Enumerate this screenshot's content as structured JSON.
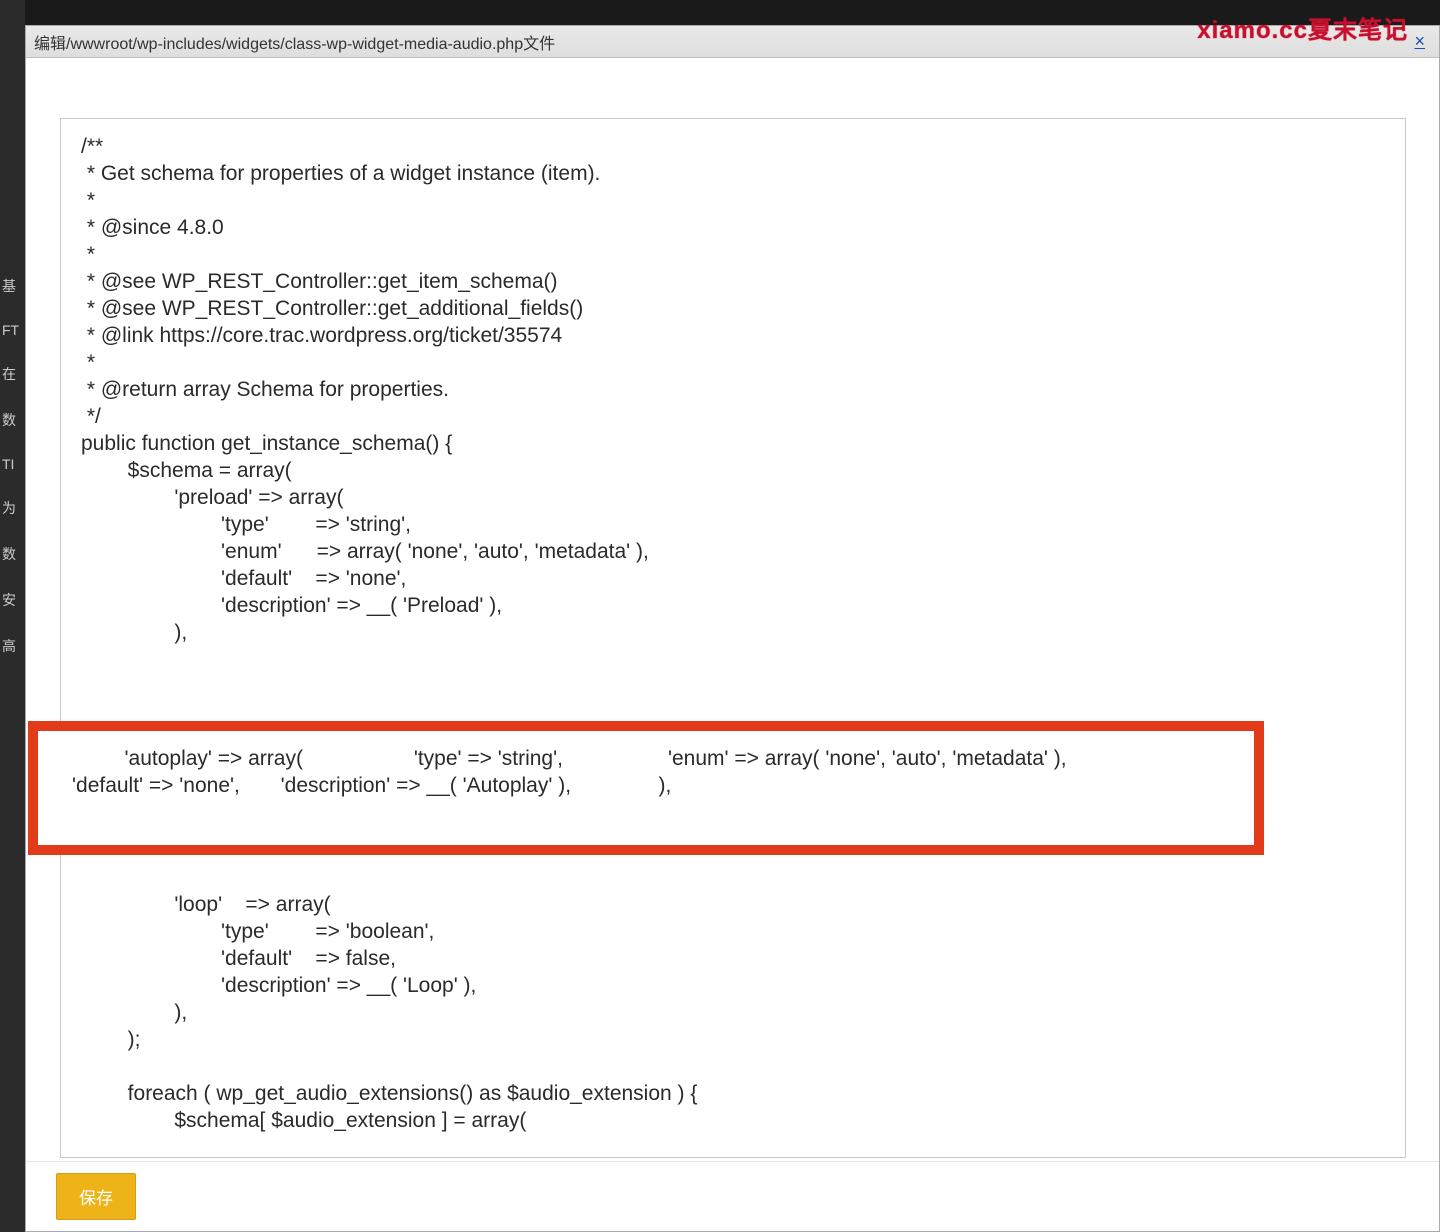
{
  "watermark": "xiamo.cc夏末笔记",
  "sidebar_items": [
    "基",
    "FT",
    "在",
    "数",
    "TI",
    "为",
    "数",
    "安",
    "高"
  ],
  "titlebar": {
    "title": "编辑/wwwroot/wp-includes/widgets/class-wp-widget-media-audio.php文件",
    "close_label": "×"
  },
  "code_before": "/**\n * Get schema for properties of a widget instance (item).\n *\n * @since 4.8.0\n *\n * @see WP_REST_Controller::get_item_schema()\n * @see WP_REST_Controller::get_additional_fields()\n * @link https://core.trac.wordpress.org/ticket/35574\n *\n * @return array Schema for properties.\n */\npublic function get_instance_schema() {\n        $schema = array(\n                'preload' => array(\n                        'type'        => 'string',\n                        'enum'      => array( 'none', 'auto', 'metadata' ),\n                        'default'    => 'none',\n                        'description' => __( 'Preload' ),\n                ),",
  "highlight_text": "         'autoplay' => array(                   'type' => 'string',                  'enum' => array( 'none', 'auto', 'metadata' ),                   'default' => 'none',       'description' => __( 'Autoplay' ),               ),",
  "code_after": "                'loop'    => array(\n                        'type'        => 'boolean',\n                        'default'    => false,\n                        'description' => __( 'Loop' ),\n                ),\n        );\n\n        foreach ( wp_get_audio_extensions() as $audio_extension ) {\n                $schema[ $audio_extension ] = array(",
  "footer": {
    "save_label": "保存"
  }
}
